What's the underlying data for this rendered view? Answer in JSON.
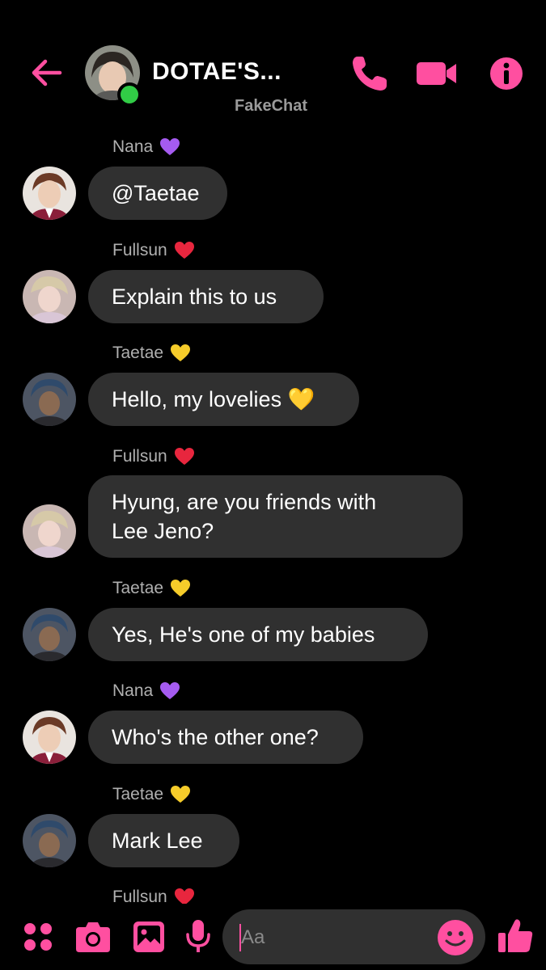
{
  "header": {
    "title": "DOTAE'S...",
    "subtitle": "FakeChat",
    "accent": "#ff4fa0",
    "online_color": "#31cc46"
  },
  "messages": [
    {
      "sender": "Nana",
      "heart": "purple",
      "text": "@Taetae"
    },
    {
      "sender": "Fullsun",
      "heart": "red",
      "text": "Explain this to us"
    },
    {
      "sender": "Taetae",
      "heart": "yellow",
      "text": "Hello, my lovelies 💛"
    },
    {
      "sender": "Fullsun",
      "heart": "red",
      "text": "Hyung, are you friends with\nLee Jeno?"
    },
    {
      "sender": "Taetae",
      "heart": "yellow",
      "text": "Yes, He's one of my babies"
    },
    {
      "sender": "Nana",
      "heart": "purple",
      "text": "Who's the other one?"
    },
    {
      "sender": "Taetae",
      "heart": "yellow",
      "text": "Mark Lee"
    },
    {
      "sender": "Fullsun",
      "heart": "red"
    }
  ],
  "composer": {
    "placeholder": "Aa"
  },
  "icons": {
    "back": "arrow-left-icon",
    "call": "phone-icon",
    "video": "video-camera-icon",
    "info": "info-icon",
    "menu": "apps-dots-icon",
    "camera": "camera-icon",
    "gallery": "image-icon",
    "mic": "microphone-icon",
    "emoji": "smiley-icon",
    "like": "thumbs-up-icon"
  }
}
